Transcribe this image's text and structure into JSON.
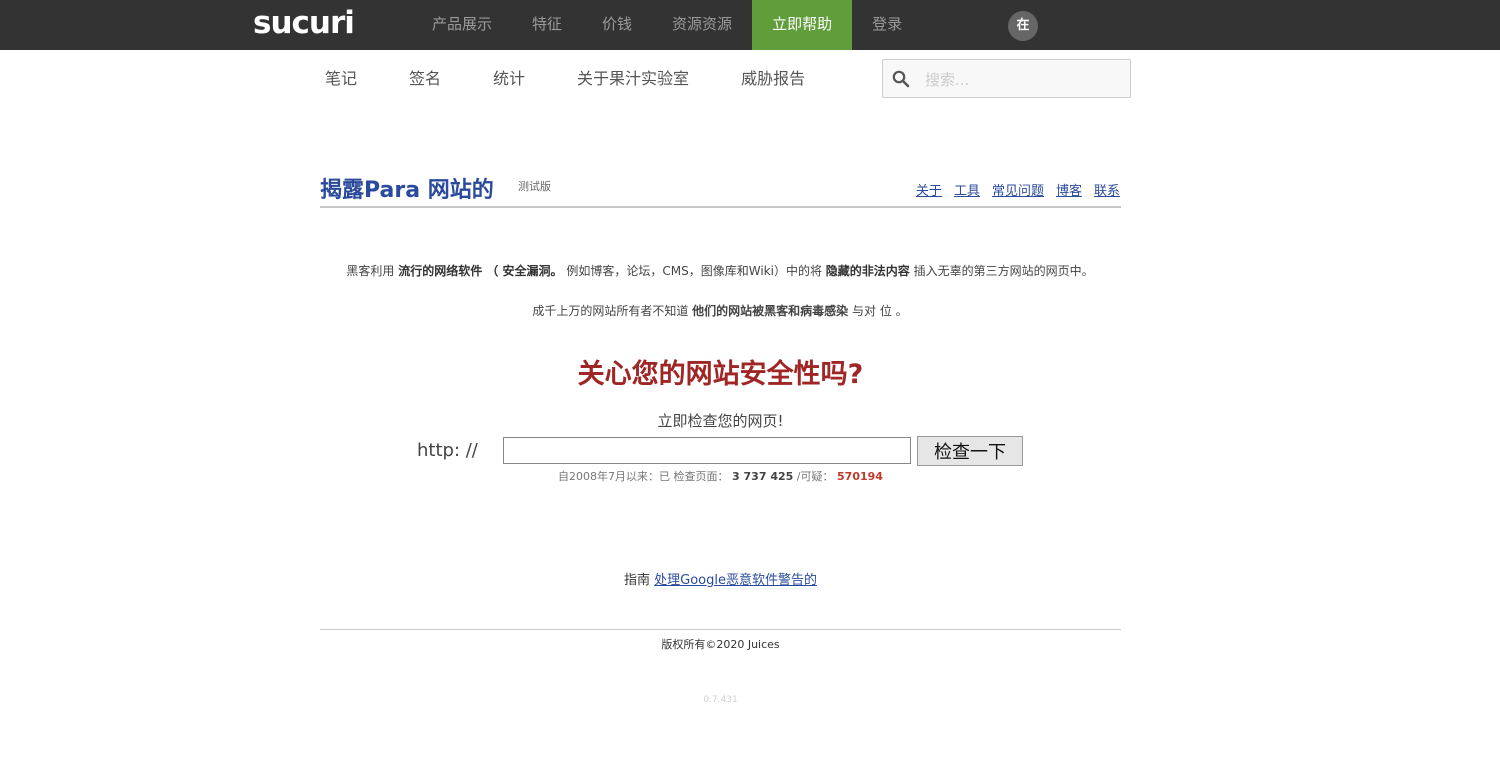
{
  "topbar": {
    "logo": "sucuri",
    "nav": [
      {
        "label": "产品展示"
      },
      {
        "label": "特征"
      },
      {
        "label": "价钱"
      },
      {
        "label": "资源资源"
      },
      {
        "label": "立即帮助"
      },
      {
        "label": "登录"
      }
    ],
    "avatar": "在",
    "active_color": "#5f9e3a"
  },
  "subnav": {
    "items": [
      {
        "label": "笔记"
      },
      {
        "label": "签名"
      },
      {
        "label": "统计"
      },
      {
        "label": "关于果汁实验室"
      },
      {
        "label": "威胁报告"
      }
    ],
    "search_placeholder": "搜索..."
  },
  "header": {
    "title": "揭露Para 网站的",
    "beta": "测试版",
    "links": [
      {
        "label": "关于"
      },
      {
        "label": "工具"
      },
      {
        "label": "常见问题"
      },
      {
        "label": "博客"
      },
      {
        "label": "联系"
      }
    ]
  },
  "intro": {
    "p1_a": "黑客利用",
    "p1_b": "流行的网络软件 （ 安全漏洞。",
    "p1_c": "例如博客，论坛，CMS，图像库和Wiki）中的将",
    "p1_d": "隐藏的非法内容",
    "p1_e": "插入无辜的第三方网站的网页中。",
    "p2_a": "成千上万的网站所有者不知道",
    "p2_b": "他们的网站被黑客和病毒感染",
    "p2_c": "与对 位 。"
  },
  "check": {
    "headline": "关心您的网站安全性吗?",
    "label": "立即检查您的网页!",
    "scheme": "http: //",
    "url_value": "",
    "button": "检查一下"
  },
  "stats": {
    "since": "自2008年7月以来：已",
    "pages_label": "检查页面：",
    "pages": "3 737 425",
    "suspicious_label": "/可疑：",
    "suspicious": "570194"
  },
  "guide": {
    "label": "指南",
    "link": "处理Google恶意软件警告的"
  },
  "footer": {
    "copyright": "版权所有©2020 Juices",
    "version": "0.7.431"
  }
}
